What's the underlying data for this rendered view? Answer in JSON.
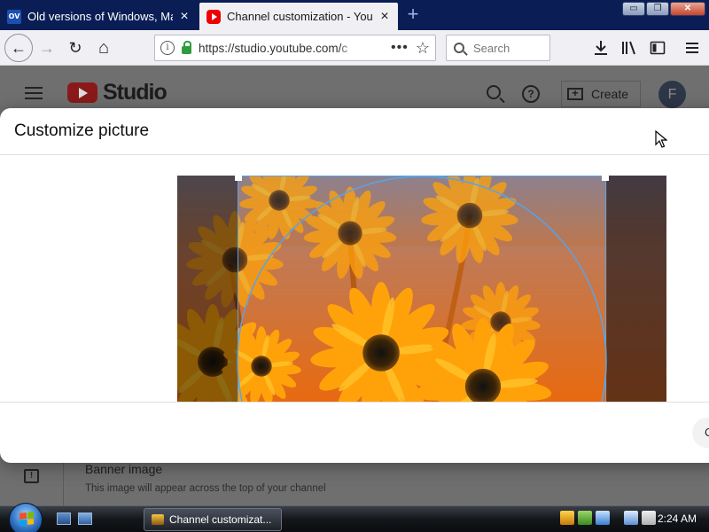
{
  "browser": {
    "tabs": [
      {
        "title": "Old versions of Windows, Mac",
        "favicon": "ov",
        "active": false
      },
      {
        "title": "Channel customization - YouT",
        "favicon": "youtube-icon",
        "active": true
      }
    ],
    "new_tab_symbol": "+",
    "window_controls": {
      "minimize": "▭",
      "maximize": "❐",
      "close": "✕"
    },
    "nav": {
      "back": "←",
      "forward": "→",
      "reload": "↻",
      "home": "⌂"
    },
    "url": {
      "host": "https://studio.youtube.com/",
      "rest": "c"
    },
    "url_actions": {
      "more": "•••",
      "bookmark": "☆"
    },
    "search_placeholder": "Search",
    "toolbar_icons": [
      "download-icon",
      "library-icon",
      "sidebar-icon",
      "menu-icon"
    ]
  },
  "studio": {
    "logo_text": "Studio",
    "create_label": "Create",
    "avatar_letter": "F",
    "help_symbol": "?",
    "feedback_symbol": "!",
    "banner_title": "Banner image",
    "banner_desc": "This image will appear across the top of your channel"
  },
  "modal": {
    "title": "Customize picture",
    "button_partial": "C"
  },
  "taskbar": {
    "window_button_label": "Channel customizat...",
    "clock": "2:24 AM"
  },
  "colors": {
    "crop_outline": "#5aa3e6",
    "tab_strip": "#0a1e55",
    "youtube_red": "#e00"
  }
}
